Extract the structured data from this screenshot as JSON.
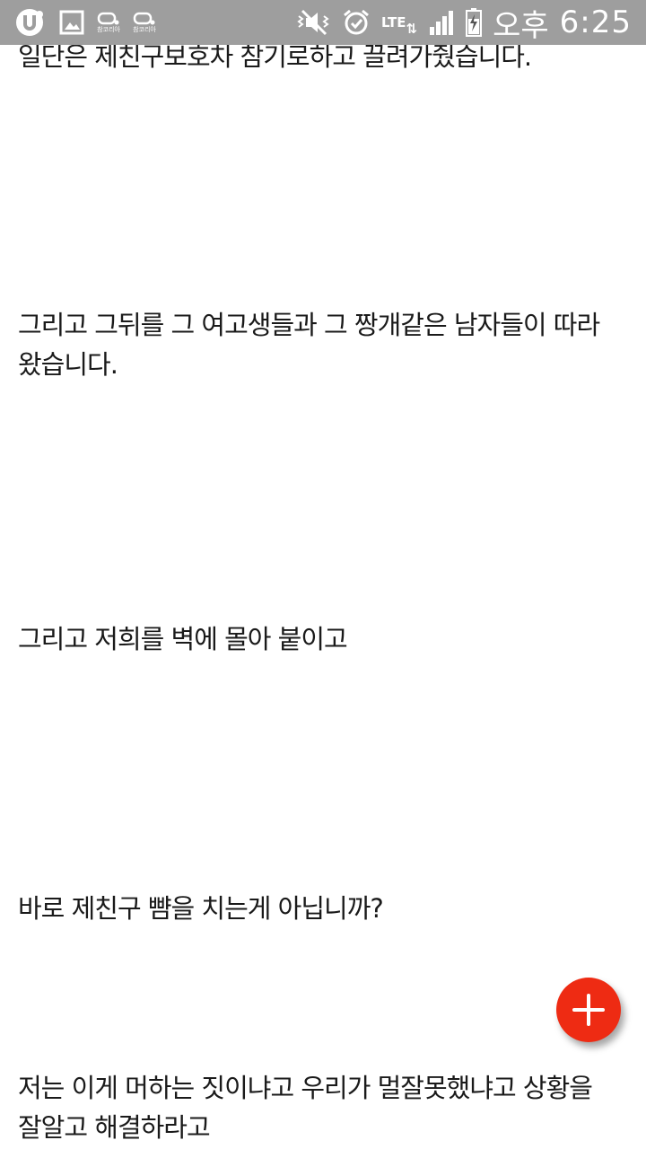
{
  "status_bar": {
    "ampm": "오후",
    "time": "6:25",
    "network": "LTE",
    "app_icon_label_1": "참코리아",
    "app_icon_label_2": "참코리아"
  },
  "article": {
    "paragraphs": [
      "일단은 제친구보호차 참기로하고 끌려가줬습니다.",
      "그리고 그뒤를 그 여고생들과 그 짱개같은 남자들이 따라 왔습니다.",
      "그리고 저희를 벽에 몰아 붙이고",
      "바로 제친구 뺨을 치는게 아닙니까?",
      "저는 이게 머하는 짓이냐고 우리가 멀잘못했냐고 상황을 잘알고 해결하라고"
    ]
  },
  "fab": {
    "icon": "plus-icon",
    "color": "#ee2b13"
  },
  "colors": {
    "status_bar": "#9e9e9e",
    "text": "#1a1a1a",
    "background": "#ffffff"
  }
}
